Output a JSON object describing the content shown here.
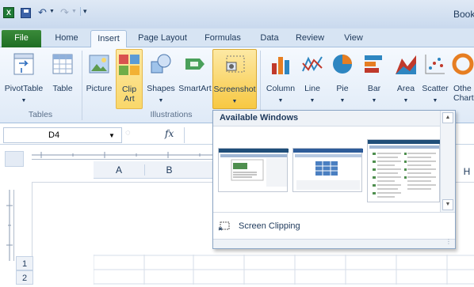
{
  "window": {
    "title_fragment": "Book"
  },
  "tabs": [
    "File",
    "Home",
    "Insert",
    "Page Layout",
    "Formulas",
    "Data",
    "Review",
    "View"
  ],
  "ribbon": {
    "buttons": {
      "pivottable": "PivotTable",
      "table": "Table",
      "picture": "Picture",
      "clipart_line1": "Clip",
      "clipart_line2": "Art",
      "shapes": "Shapes",
      "smartart": "SmartArt",
      "screenshot": "Screenshot",
      "column": "Column",
      "line": "Line",
      "pie": "Pie",
      "bar": "Bar",
      "area": "Area",
      "scatter": "Scatter",
      "other_line1": "Othe",
      "other_line2": "Charts"
    },
    "groups": {
      "tables": "Tables",
      "illustrations": "Illustrations"
    }
  },
  "formula_bar": {
    "name_box": "D4",
    "fx": "fx"
  },
  "sheet": {
    "columns": [
      "A",
      "B",
      "H"
    ],
    "rows": [
      "1",
      "2"
    ]
  },
  "dropdown": {
    "header": "Available Windows",
    "screen_clipping": "Screen Clipping"
  },
  "colors": {
    "file_tab": "#2a7d2e",
    "ribbon": "#dfeaf7",
    "accent": "#f7c842"
  }
}
